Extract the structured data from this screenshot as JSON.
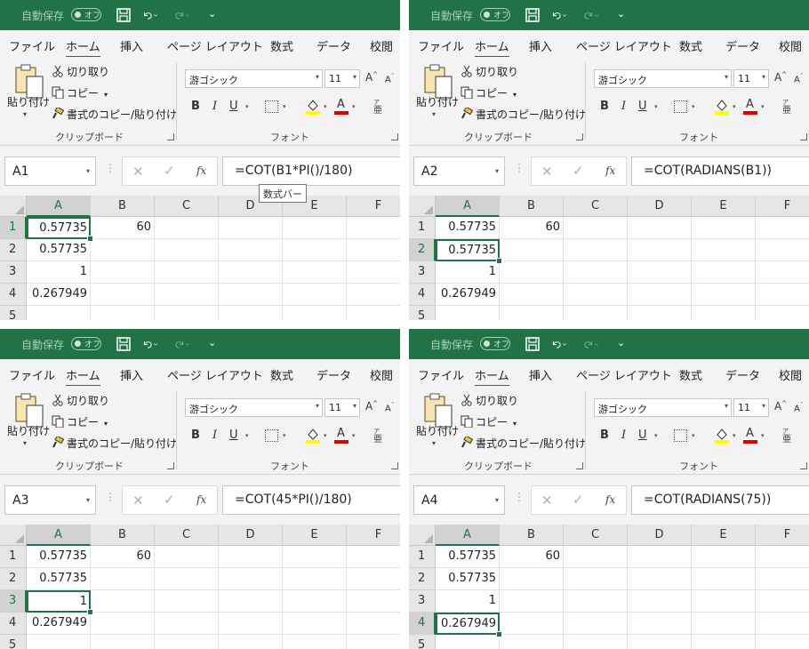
{
  "titlebar": {
    "autosave_label": "自動保存",
    "autosave_state": "オフ",
    "qat_more": "⌄"
  },
  "tabs": [
    "ファイル",
    "ホーム",
    "挿入",
    "ページ レイアウト",
    "数式",
    "データ",
    "校閲"
  ],
  "active_tab": "ホーム",
  "ribbon": {
    "paste_label": "貼り付け",
    "cut_label": "切り取り",
    "copy_label": "コピー",
    "format_painter_label": "書式のコピー/貼り付け",
    "clipboard_group": "クリップボード",
    "font_name": "游ゴシック",
    "font_size": "11",
    "font_group": "フォント",
    "bold": "B",
    "italic": "I",
    "underline": "U",
    "font_increase": "A",
    "font_decrease": "A",
    "font_color_letter": "A",
    "phonetic": "亜",
    "fill_color": "#ffff00",
    "font_color": "#e00000"
  },
  "grid": {
    "columns": [
      "A",
      "B",
      "C",
      "D",
      "E",
      "F"
    ],
    "rows": [
      "1",
      "2",
      "3",
      "4",
      "5"
    ],
    "cells": {
      "A1": "0.57735",
      "B1": "60",
      "A2": "0.57735",
      "A3": "1",
      "A4": "0.267949"
    }
  },
  "panes": [
    {
      "name_box": "A1",
      "formula": "=COT(B1*PI()/180)",
      "active_cell": "A1",
      "tooltip": "数式バー"
    },
    {
      "name_box": "A2",
      "formula": "=COT(RADIANS(B1))",
      "active_cell": "A2"
    },
    {
      "name_box": "A3",
      "formula": "=COT(45*PI()/180)",
      "active_cell": "A3"
    },
    {
      "name_box": "A4",
      "formula": "=COT(RADIANS(75))",
      "active_cell": "A4"
    }
  ],
  "colors": {
    "excel_green": "#217346",
    "ribbon_bg": "#f3f3f3"
  }
}
